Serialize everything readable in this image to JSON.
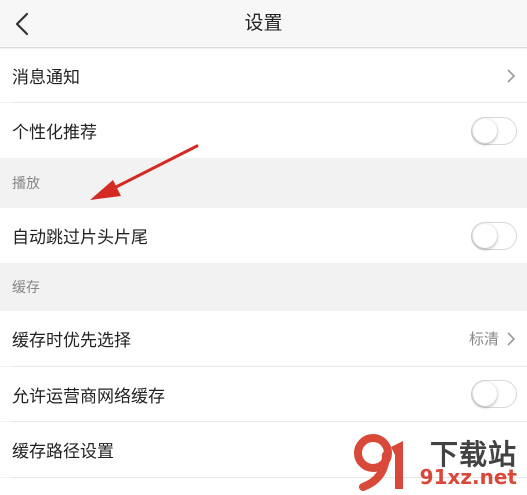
{
  "header": {
    "title": "设置",
    "back_icon": "chevron-left-icon"
  },
  "rows": {
    "notifications": {
      "label": "消息通知"
    },
    "personalized": {
      "label": "个性化推荐",
      "toggle": false
    },
    "skip_intro": {
      "label": "自动跳过片头片尾",
      "toggle": false
    },
    "cache_priority": {
      "label": "缓存时优先选择",
      "value": "标清"
    },
    "carrier_cache": {
      "label": "允许运营商网络缓存",
      "toggle": false
    },
    "cache_path": {
      "label": "缓存路径设置"
    }
  },
  "sections": {
    "playback": "播放",
    "cache": "缓存"
  },
  "watermark": {
    "brand": "下载站",
    "site": "91xz.net",
    "logo_mark": "9"
  },
  "annotation": {
    "color": "#d42a24"
  },
  "colors": {
    "background": "#f2f2f2",
    "row": "#ffffff",
    "secondary_text": "#888888"
  }
}
